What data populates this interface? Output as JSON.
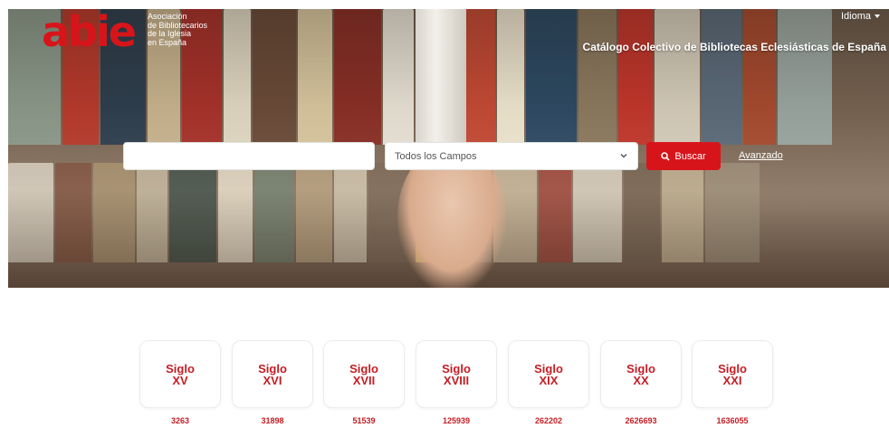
{
  "header": {
    "logo_mark": "abie",
    "logo_lines": [
      "Asociación",
      "de Bibliotecarios",
      "de la Iglesia",
      "en España"
    ],
    "language_label": "Idioma",
    "catalog_title": "Catálogo Colectivo de Bibliotecas Eclesiásticas de España"
  },
  "search": {
    "query": "",
    "field_selected": "Todos los Campos",
    "button_label": "Buscar",
    "advanced_label": "Avanzado"
  },
  "centuries": [
    {
      "line1": "Siglo",
      "line2": "XV",
      "count": "3263"
    },
    {
      "line1": "Siglo",
      "line2": "XVI",
      "count": "31898"
    },
    {
      "line1": "Siglo",
      "line2": "XVII",
      "count": "51539"
    },
    {
      "line1": "Siglo",
      "line2": "XVIII",
      "count": "125939"
    },
    {
      "line1": "Siglo",
      "line2": "XIX",
      "count": "262202"
    },
    {
      "line1": "Siglo",
      "line2": "XX",
      "count": "2626693"
    },
    {
      "line1": "Siglo",
      "line2": "XXI",
      "count": "1636055"
    }
  ],
  "colors": {
    "brand_red": "#d8141b",
    "card_text": "#c41d24"
  },
  "icons": {
    "search": "search-icon",
    "dropdown": "chevron-down-icon",
    "language_caret": "caret-down-icon"
  }
}
